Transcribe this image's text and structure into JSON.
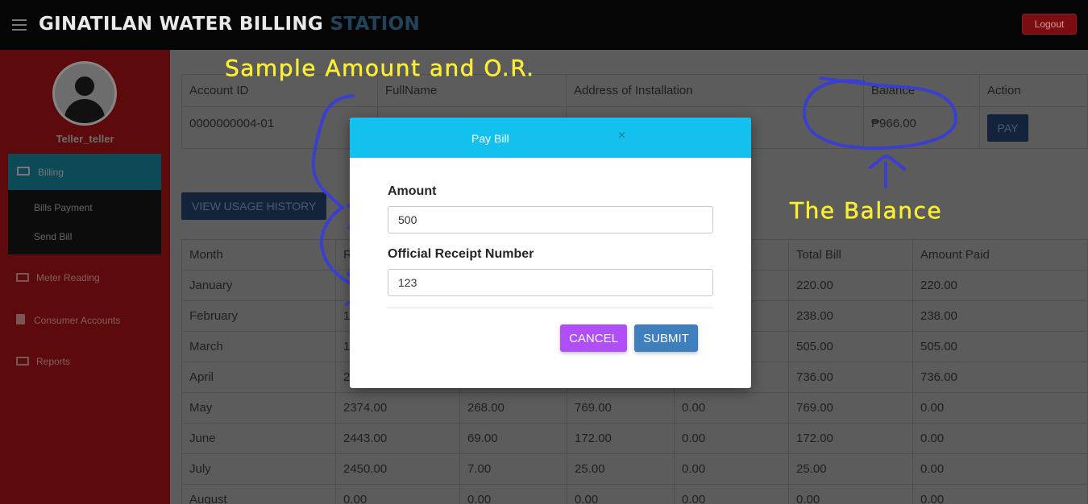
{
  "header": {
    "title_main": "GINATILAN WATER BILLING",
    "title_accent": "STATION",
    "logout_label": "Logout"
  },
  "sidebar": {
    "username": "Teller_teller",
    "billing_label": "Billing",
    "submenu": [
      "Bills Payment",
      "Send Bill"
    ],
    "items": [
      "Meter Reading",
      "Consumer Accounts",
      "Reports"
    ]
  },
  "account_table": {
    "headers": [
      "Account ID",
      "FullName",
      "Address of Installation",
      "Balance",
      "Action"
    ],
    "row": {
      "account_id": "0000000004-01",
      "fullname": "",
      "address": "",
      "balance": "₱966.00",
      "action_label": "PAY"
    }
  },
  "usage_button_label": "VIEW USAGE HISTORY",
  "usage_table": {
    "headers": [
      "Month",
      "R",
      "",
      "",
      "",
      "Total Bill",
      "Amount Paid"
    ],
    "rows": [
      [
        "January",
        "",
        "",
        "",
        "",
        "220.00",
        "220.00"
      ],
      [
        "February",
        "1",
        "",
        "",
        "",
        "238.00",
        "238.00"
      ],
      [
        "March",
        "1",
        "",
        "",
        "",
        "505.00",
        "505.00"
      ],
      [
        "April",
        "2",
        "",
        "",
        "",
        "736.00",
        "736.00"
      ],
      [
        "May",
        "2374.00",
        "268.00",
        "769.00",
        "0.00",
        "769.00",
        "0.00"
      ],
      [
        "June",
        "2443.00",
        "69.00",
        "172.00",
        "0.00",
        "172.00",
        "0.00"
      ],
      [
        "July",
        "2450.00",
        "7.00",
        "25.00",
        "0.00",
        "25.00",
        "0.00"
      ],
      [
        "August",
        "0.00",
        "0.00",
        "0.00",
        "0.00",
        "0.00",
        "0.00"
      ]
    ]
  },
  "modal": {
    "title": "Pay Bill",
    "close_symbol": "×",
    "amount_label": "Amount",
    "amount_value": "500",
    "or_label": "Official Receipt Number",
    "or_value": "123",
    "cancel_label": "CANCEL",
    "submit_label": "SUBMIT"
  },
  "annotations": {
    "sample_text": "Sample Amount and O.R.",
    "balance_text": "The Balance",
    "color": "#fbef35",
    "ink_color": "#3a3fd0"
  }
}
